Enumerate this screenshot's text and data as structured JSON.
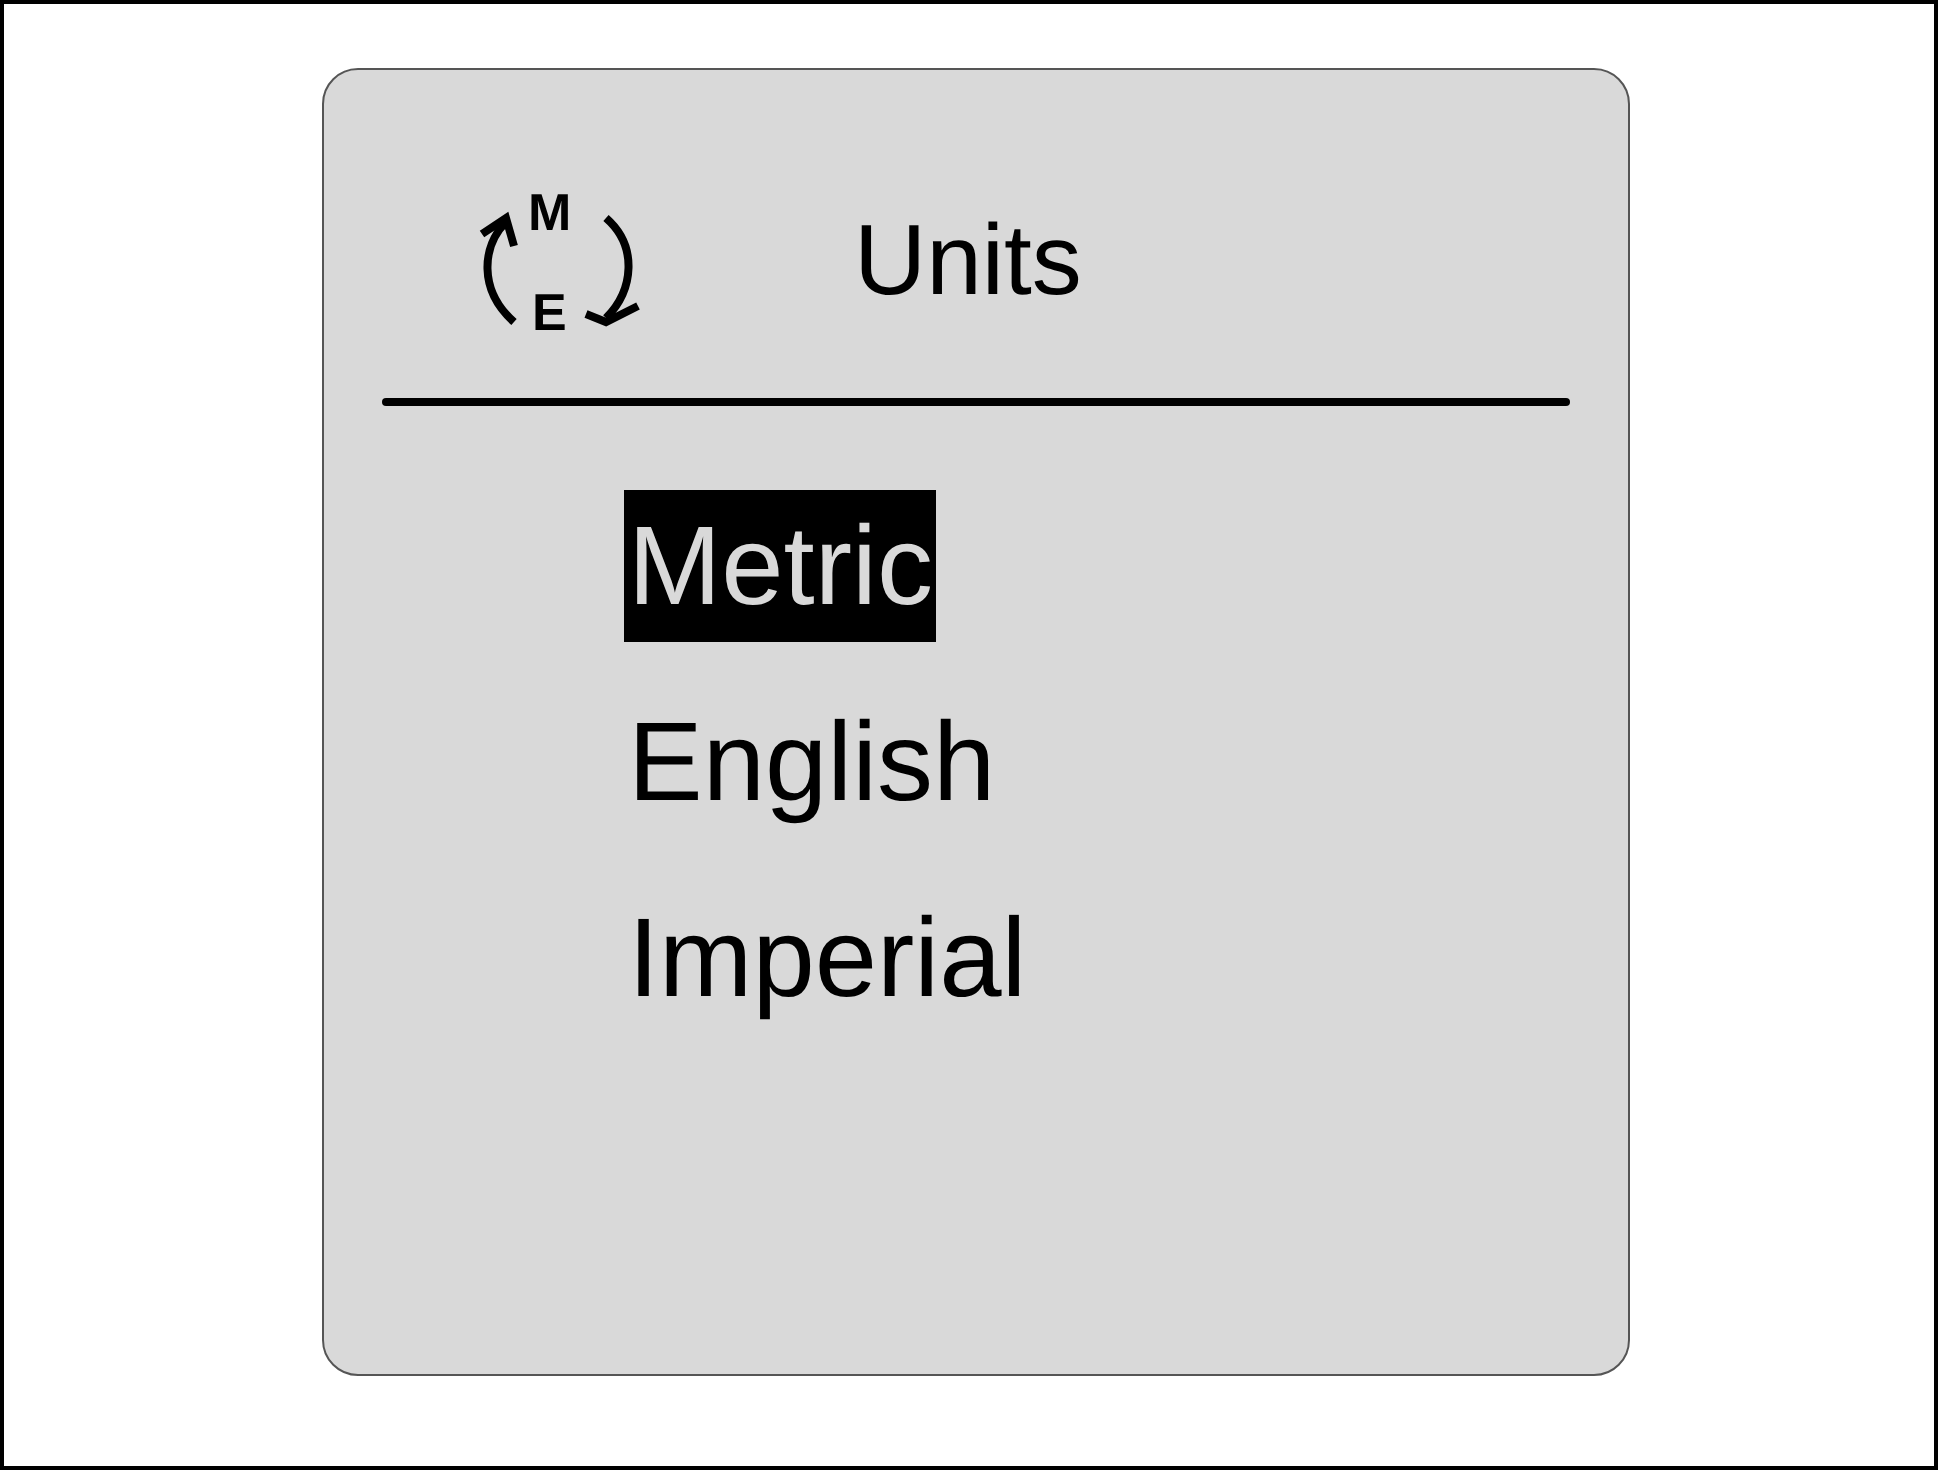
{
  "screen": {
    "icon_letters": [
      "M",
      "E"
    ],
    "title": "Units"
  },
  "options": [
    {
      "label": "Metric",
      "selected": true
    },
    {
      "label": "English",
      "selected": false
    },
    {
      "label": "Imperial",
      "selected": false
    }
  ]
}
